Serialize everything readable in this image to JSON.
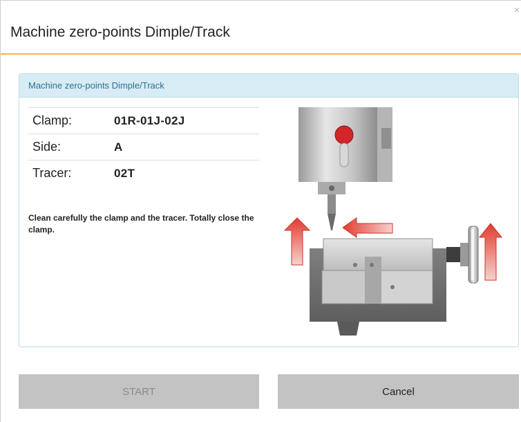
{
  "dialog": {
    "title": "Machine zero-points Dimple/Track",
    "close_glyph": "×"
  },
  "panel": {
    "header": "Machine zero-points Dimple/Track",
    "rows": [
      {
        "label": "Clamp:",
        "value": "01R-01J-02J"
      },
      {
        "label": "Side:",
        "value": "A"
      },
      {
        "label": "Tracer:",
        "value": "02T"
      }
    ],
    "instructions": "Clean carefully the clamp and the tracer. Totally close the clamp.",
    "illustration_icon": "key-machine-clamp-tracer-illustration"
  },
  "buttons": {
    "start": "START",
    "cancel": "Cancel"
  },
  "colors": {
    "title_rule": "#f0b840",
    "panel_header_bg": "#d7ecf5",
    "panel_header_text": "#2f6f95",
    "button_bg": "#c3c3c3",
    "arrow_red": "#e23b30"
  }
}
